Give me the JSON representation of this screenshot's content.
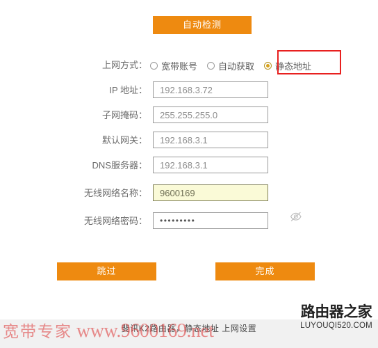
{
  "toolbar": {
    "auto_detect_label": "自动检测"
  },
  "connection_mode": {
    "label": "上网方式：",
    "options": [
      {
        "label": "宽带账号",
        "selected": false
      },
      {
        "label": "自动获取",
        "selected": false
      },
      {
        "label": "静态地址",
        "selected": true
      }
    ],
    "highlight_color": "#e8201f"
  },
  "fields": [
    {
      "name": "ip-address",
      "label": "IP 地址：",
      "value": "192.168.3.72",
      "type": "text",
      "autofill": false
    },
    {
      "name": "subnet-mask",
      "label": "子网掩码：",
      "value": "255.255.255.0",
      "type": "text",
      "autofill": false
    },
    {
      "name": "default-gateway",
      "label": "默认网关：",
      "value": "192.168.3.1",
      "type": "text",
      "autofill": false
    },
    {
      "name": "dns-server",
      "label": "DNS服务器：",
      "value": "192.168.3.1",
      "type": "text",
      "autofill": false
    },
    {
      "name": "wifi-ssid",
      "label": "无线网络名称：",
      "value": "9600169",
      "type": "text",
      "autofill": true
    },
    {
      "name": "wifi-password",
      "label": "无线网络密码：",
      "value": "•••••••••",
      "type": "password",
      "autofill": false
    }
  ],
  "password_toggle": {
    "icon": "eye-slash-icon"
  },
  "actions": {
    "skip_label": "跳过",
    "finish_label": "完成",
    "button_color": "#ee8a10"
  },
  "footer": {
    "caption": "斐讯K2路由器，静态地址 上网设置",
    "watermark_cn": "宽带专家",
    "watermark_url": "www.9600169.net",
    "brand_cn": "路由器之家",
    "brand_en": "LUYOUQI520.COM"
  }
}
